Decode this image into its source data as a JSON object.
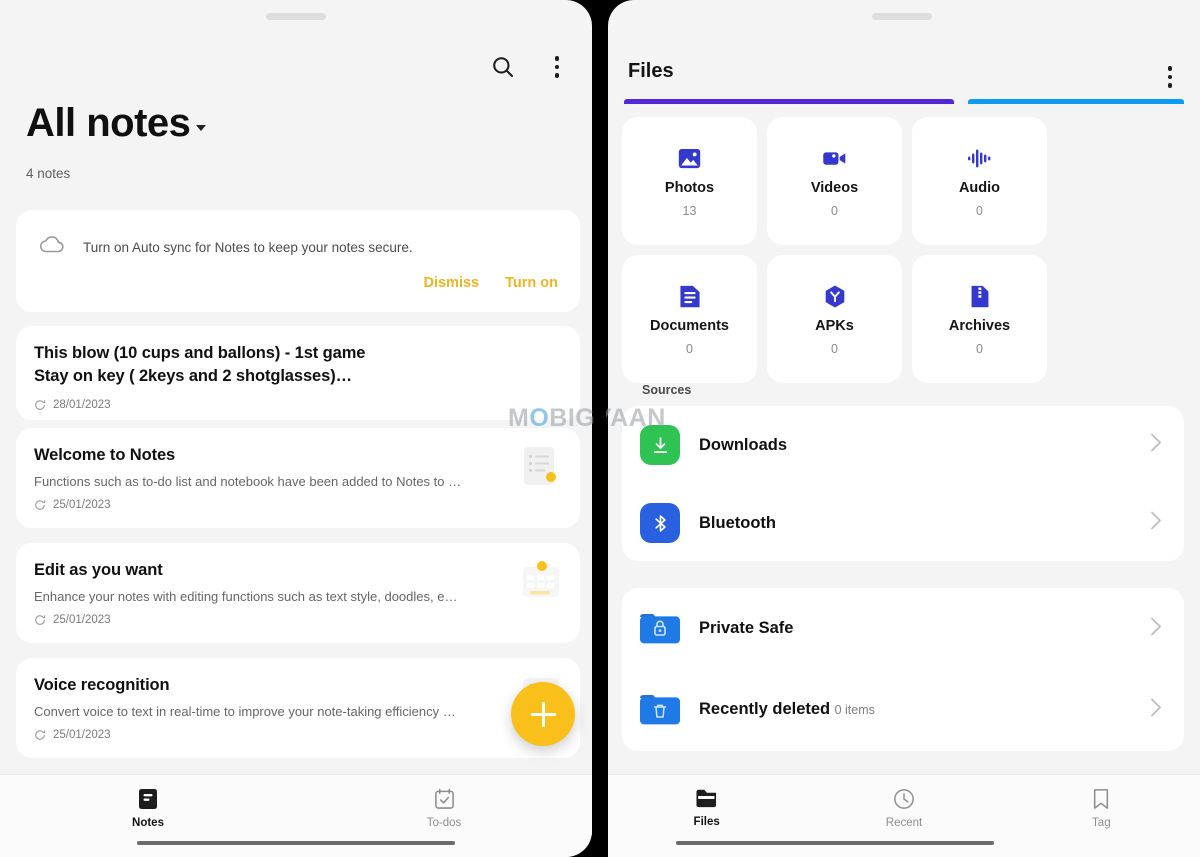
{
  "notes_app": {
    "topbar": {
      "search_icon": "search-icon",
      "more_icon": "more-vertical-icon"
    },
    "title": "All notes",
    "count_label": "4 notes",
    "sync_banner": {
      "icon": "cloud-icon",
      "message": "Turn on Auto sync for Notes to keep your notes secure.",
      "dismiss_label": "Dismiss",
      "turn_on_label": "Turn on",
      "accent_color": "#f0b323"
    },
    "notes": [
      {
        "title": "This blow (10 cups and ballons) - 1st game",
        "title2": "Stay on key ( 2keys and 2 shotglasses)…",
        "snippet": "",
        "date": "28/01/2023",
        "has_thumb": false
      },
      {
        "title": "Welcome to Notes",
        "title2": "",
        "snippet": "Functions such as to-do list and notebook have been added to Notes to …",
        "date": "25/01/2023",
        "has_thumb": true
      },
      {
        "title": "Edit as you want",
        "title2": "",
        "snippet": "Enhance your notes with editing functions such as text style, doodles, e…",
        "date": "25/01/2023",
        "has_thumb": true
      },
      {
        "title": "Voice recognition",
        "title2": "",
        "snippet": "Convert voice to text in real-time to improve your note-taking efficiency …",
        "date": "25/01/2023",
        "has_thumb": true
      }
    ],
    "fab": {
      "icon": "plus-icon",
      "color": "#f9c01c"
    },
    "bottom_nav": [
      {
        "label": "Notes",
        "icon": "notebook-icon",
        "active": true
      },
      {
        "label": "To-dos",
        "icon": "checklist-icon",
        "active": false
      }
    ]
  },
  "files_app": {
    "title": "Files",
    "more_icon": "more-vertical-icon",
    "storage_bars": [
      {
        "name": "internal-storage-bar",
        "color": "#5128d6"
      },
      {
        "name": "sd-card-bar",
        "color": "#0b9cf0"
      }
    ],
    "categories": [
      {
        "label": "Photos",
        "count": "13",
        "icon": "image-icon"
      },
      {
        "label": "Videos",
        "count": "0",
        "icon": "video-camera-icon"
      },
      {
        "label": "Audio",
        "count": "0",
        "icon": "waveform-icon"
      },
      {
        "label": "Documents",
        "count": "0",
        "icon": "document-icon"
      },
      {
        "label": "APKs",
        "count": "0",
        "icon": "apk-package-icon"
      },
      {
        "label": "Archives",
        "count": "0",
        "icon": "zip-archive-icon"
      }
    ],
    "category_icon_color": "#3538cd",
    "sources_label": "Sources",
    "sources": [
      {
        "label": "Downloads",
        "sub": "",
        "icon": "download-icon",
        "color": "#2ec352"
      },
      {
        "label": "Bluetooth",
        "sub": "",
        "icon": "bluetooth-icon",
        "color": "#2860e0"
      }
    ],
    "vault": [
      {
        "label": "Private Safe",
        "sub": "",
        "icon": "lock-folder-icon",
        "color": "#1f7ae6"
      },
      {
        "label": "Recently deleted",
        "sub": "0 items",
        "icon": "trash-folder-icon",
        "color": "#1f7ae6"
      }
    ],
    "bottom_nav": [
      {
        "label": "Files",
        "icon": "folder-icon",
        "active": true
      },
      {
        "label": "Recent",
        "icon": "clock-icon",
        "active": false
      },
      {
        "label": "Tag",
        "icon": "bookmark-icon",
        "active": false
      }
    ]
  },
  "watermark": {
    "pre": "M",
    "ring": "O",
    "post": "BIGYAAN"
  }
}
